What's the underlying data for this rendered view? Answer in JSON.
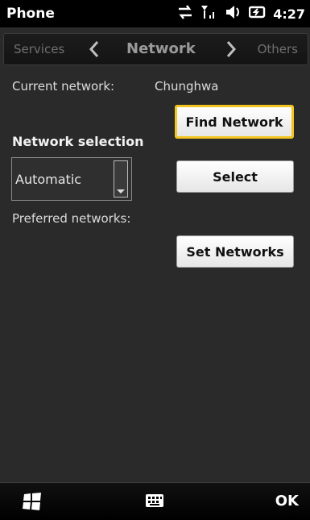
{
  "status": {
    "title": "Phone",
    "time": "4:27",
    "icons": [
      "sync-icon",
      "signal-icon",
      "volume-icon",
      "battery-icon"
    ]
  },
  "tabs": {
    "prev": "Services",
    "current": "Network",
    "next": "Others"
  },
  "content": {
    "current_network_label": "Current network:",
    "current_network_value": "Chunghwa",
    "find_network_button": "Find Network",
    "network_selection_label": "Network selection",
    "network_selection_value": "Automatic",
    "select_button": "Select",
    "preferred_networks_label": "Preferred networks:",
    "set_networks_button": "Set Networks"
  },
  "softkeys": {
    "right": "OK",
    "icons": [
      "windows-start-icon",
      "keyboard-icon"
    ]
  },
  "colors": {
    "background": "#2a2a2a",
    "focus": "#f3c51f",
    "button": "#ffffff"
  }
}
